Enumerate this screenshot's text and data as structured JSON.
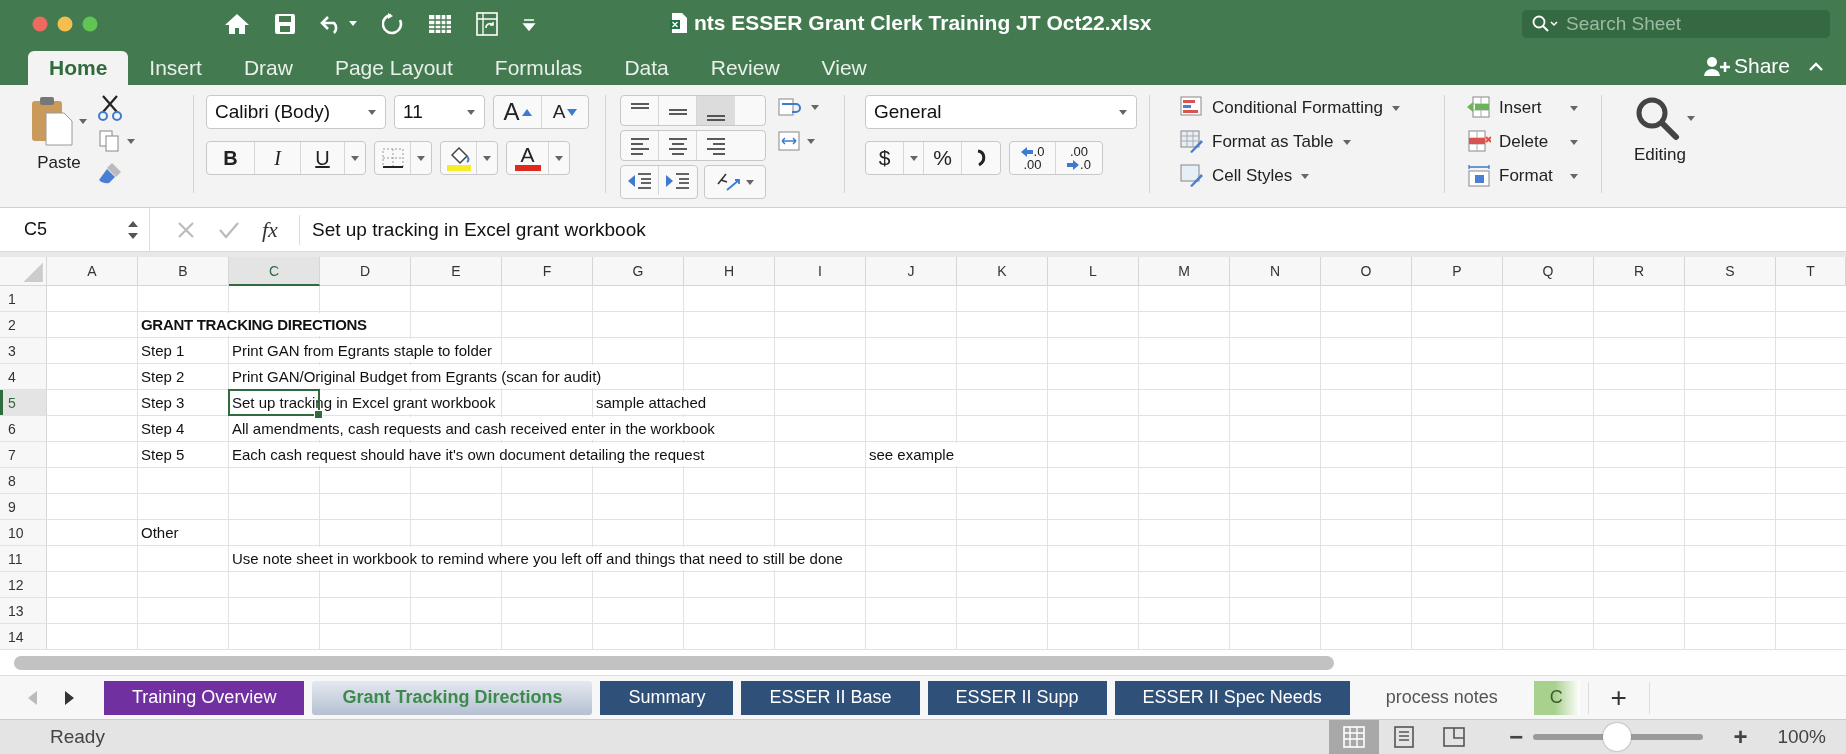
{
  "window": {
    "title": "nts ESSER Grant Clerk Training JT Oct22.xlsx"
  },
  "search": {
    "placeholder": "Search Sheet"
  },
  "ribbon_tabs": [
    {
      "label": "Home",
      "selected": true
    },
    {
      "label": "Insert",
      "selected": false
    },
    {
      "label": "Draw",
      "selected": false
    },
    {
      "label": "Page Layout",
      "selected": false
    },
    {
      "label": "Formulas",
      "selected": false
    },
    {
      "label": "Data",
      "selected": false
    },
    {
      "label": "Review",
      "selected": false
    },
    {
      "label": "View",
      "selected": false
    }
  ],
  "share": {
    "label": "Share"
  },
  "clipboard": {
    "paste_label": "Paste"
  },
  "font": {
    "name": "Calibri (Body)",
    "size": "11",
    "grow": "A",
    "shrink": "A",
    "bold": "B",
    "italic": "I",
    "underline": "U",
    "color_label": "A"
  },
  "number": {
    "format": "General",
    "currency": "$",
    "percent": "%",
    "increase_decimal": [
      ".0",
      ".00"
    ],
    "decrease_decimal": [
      ".00",
      ".0"
    ]
  },
  "styles": [
    {
      "label": "Conditional Formatting",
      "kind": "conditional"
    },
    {
      "label": "Format as Table",
      "kind": "table"
    },
    {
      "label": "Cell Styles",
      "kind": "styles"
    }
  ],
  "cells": [
    {
      "label": "Insert",
      "kind": "insert"
    },
    {
      "label": "Delete",
      "kind": "delete"
    },
    {
      "label": "Format",
      "kind": "format"
    }
  ],
  "editing": {
    "label": "Editing"
  },
  "formula_bar": {
    "name_box": "C5",
    "fx": "fx",
    "formula": "Set up tracking in Excel grant workbook"
  },
  "sheet": {
    "columns": [
      {
        "label": "A",
        "selected": false
      },
      {
        "label": "B",
        "selected": false
      },
      {
        "label": "C",
        "selected": true
      },
      {
        "label": "D",
        "selected": false
      },
      {
        "label": "E",
        "selected": false
      },
      {
        "label": "F",
        "selected": false
      },
      {
        "label": "G",
        "selected": false
      },
      {
        "label": "H",
        "selected": false
      },
      {
        "label": "I",
        "selected": false
      },
      {
        "label": "J",
        "selected": false
      },
      {
        "label": "K",
        "selected": false
      },
      {
        "label": "L",
        "selected": false
      },
      {
        "label": "M",
        "selected": false
      },
      {
        "label": "N",
        "selected": false
      },
      {
        "label": "O",
        "selected": false
      },
      {
        "label": "P",
        "selected": false
      },
      {
        "label": "Q",
        "selected": false
      },
      {
        "label": "R",
        "selected": false
      },
      {
        "label": "S",
        "selected": false
      },
      {
        "label": "T",
        "selected": false
      }
    ],
    "rows": [
      {
        "label": "1",
        "selected": false
      },
      {
        "label": "2",
        "selected": false,
        "cells": [
          null,
          {
            "text": "GRANT TRACKING DIRECTIONS",
            "bold": true,
            "selected": false
          }
        ]
      },
      {
        "label": "3",
        "selected": false,
        "cells": [
          null,
          {
            "text": "Step 1",
            "bold": false,
            "selected": false
          },
          {
            "text": "Print GAN from Egrants staple to folder",
            "bold": false,
            "selected": false
          }
        ]
      },
      {
        "label": "4",
        "selected": false,
        "cells": [
          null,
          {
            "text": "Step 2",
            "bold": false,
            "selected": false
          },
          {
            "text": "Print GAN/Original Budget from Egrants (scan for audit)",
            "bold": false,
            "selected": false
          }
        ]
      },
      {
        "label": "5",
        "selected": true,
        "cells": [
          null,
          {
            "text": "Step 3",
            "bold": false,
            "selected": false
          },
          {
            "text": "Set up tracking in Excel grant workbook",
            "bold": false,
            "selected": true
          },
          null,
          null,
          null,
          {
            "text": "sample attached",
            "bold": false,
            "selected": false
          }
        ]
      },
      {
        "label": "6",
        "selected": false,
        "cells": [
          null,
          {
            "text": "Step 4",
            "bold": false,
            "selected": false
          },
          {
            "text": "All amendments, cash requests and cash received enter in the workbook",
            "bold": false,
            "selected": false
          }
        ]
      },
      {
        "label": "7",
        "selected": false,
        "cells": [
          null,
          {
            "text": "Step 5",
            "bold": false,
            "selected": false
          },
          {
            "text": "Each cash request should have it's own document detailing the request",
            "bold": false,
            "selected": false
          },
          null,
          null,
          null,
          null,
          null,
          null,
          {
            "text": "see example",
            "bold": false,
            "selected": false
          }
        ]
      },
      {
        "label": "8",
        "selected": false
      },
      {
        "label": "9",
        "selected": false
      },
      {
        "label": "10",
        "selected": false,
        "cells": [
          null,
          {
            "text": "Other",
            "bold": false,
            "selected": false
          }
        ]
      },
      {
        "label": "11",
        "selected": false,
        "cells": [
          null,
          null,
          {
            "text": "Use note sheet in workbook to remind where you left off and things that need to still be done",
            "bold": false,
            "selected": false
          }
        ]
      },
      {
        "label": "12",
        "selected": false
      },
      {
        "label": "13",
        "selected": false
      },
      {
        "label": "14",
        "selected": false
      }
    ]
  },
  "sheet_tabs": [
    {
      "label": "Training Overview",
      "color": "#7030a0",
      "selected": false
    },
    {
      "label": "Grant Tracking Directions",
      "selected": true
    },
    {
      "label": "Summary",
      "color": "#2f5078",
      "selected": false
    },
    {
      "label": "ESSER II Base",
      "color": "#2f5078",
      "selected": false
    },
    {
      "label": "ESSER II Supp",
      "color": "#2f5078",
      "selected": false
    },
    {
      "label": "ESSER II Spec Needs",
      "color": "#2f5078",
      "selected": false
    },
    {
      "label": "process notes",
      "selected": false
    },
    {
      "label": "C",
      "color": "#a9d18e",
      "selected": false
    }
  ],
  "add_sheet": "+",
  "status_bar": {
    "text": "Ready",
    "views": [
      {
        "kind": "normal",
        "selected": true
      },
      {
        "kind": "page_layout",
        "selected": false
      },
      {
        "kind": "page_break",
        "selected": false
      }
    ],
    "zoom_out": "−",
    "zoom": {
      "level": 0.49
    },
    "zoom_in": "+",
    "zoom_label": "100%"
  }
}
